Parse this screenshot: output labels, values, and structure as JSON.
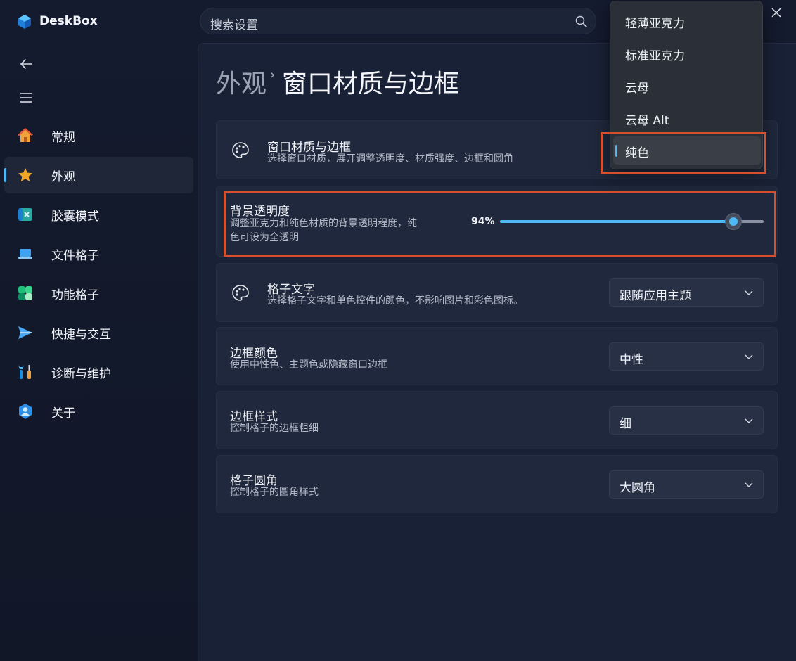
{
  "app": {
    "name": "DeskBox"
  },
  "search": {
    "placeholder": "搜索设置"
  },
  "sidebar": {
    "items": [
      {
        "label": "常规",
        "icon": "home-icon",
        "active": false
      },
      {
        "label": "外观",
        "icon": "star-icon",
        "active": true
      },
      {
        "label": "胶囊模式",
        "icon": "capsule-icon",
        "active": false
      },
      {
        "label": "文件格子",
        "icon": "laptop-icon",
        "active": false
      },
      {
        "label": "功能格子",
        "icon": "grid-icon",
        "active": false
      },
      {
        "label": "快捷与交互",
        "icon": "send-icon",
        "active": false
      },
      {
        "label": "诊断与维护",
        "icon": "tools-icon",
        "active": false
      },
      {
        "label": "关于",
        "icon": "about-icon",
        "active": false
      }
    ]
  },
  "breadcrumb": {
    "parent": "外观",
    "separator": "›",
    "current": "窗口材质与边框"
  },
  "cards": {
    "material": {
      "title": "窗口材质与边框",
      "desc": "选择窗口材质，展开调整透明度、材质强度、边框和圆角"
    },
    "opacity": {
      "title": "背景透明度",
      "desc_line1": "调整亚克力和纯色材质的背景透明程度，纯",
      "desc_line2": "色可设为全透明",
      "value_text": "94%",
      "value": 94
    },
    "text": {
      "title": "格子文字",
      "desc": "选择格子文字和单色控件的颜色，不影响图片和彩色图标。",
      "value": "跟随应用主题"
    },
    "border_color": {
      "title": "边框颜色",
      "desc": "使用中性色、主题色或隐藏窗口边框",
      "value": "中性"
    },
    "border_style": {
      "title": "边框样式",
      "desc": "控制格子的边框粗细",
      "value": "细"
    },
    "corner": {
      "title": "格子圆角",
      "desc": "控制格子的圆角样式",
      "value": "大圆角"
    }
  },
  "material_menu": {
    "options": [
      "轻薄亚克力",
      "标准亚克力",
      "云母",
      "云母 Alt",
      "纯色"
    ],
    "selected": "纯色"
  },
  "colors": {
    "accent": "#4db8f5",
    "highlight": "#d6502e"
  }
}
